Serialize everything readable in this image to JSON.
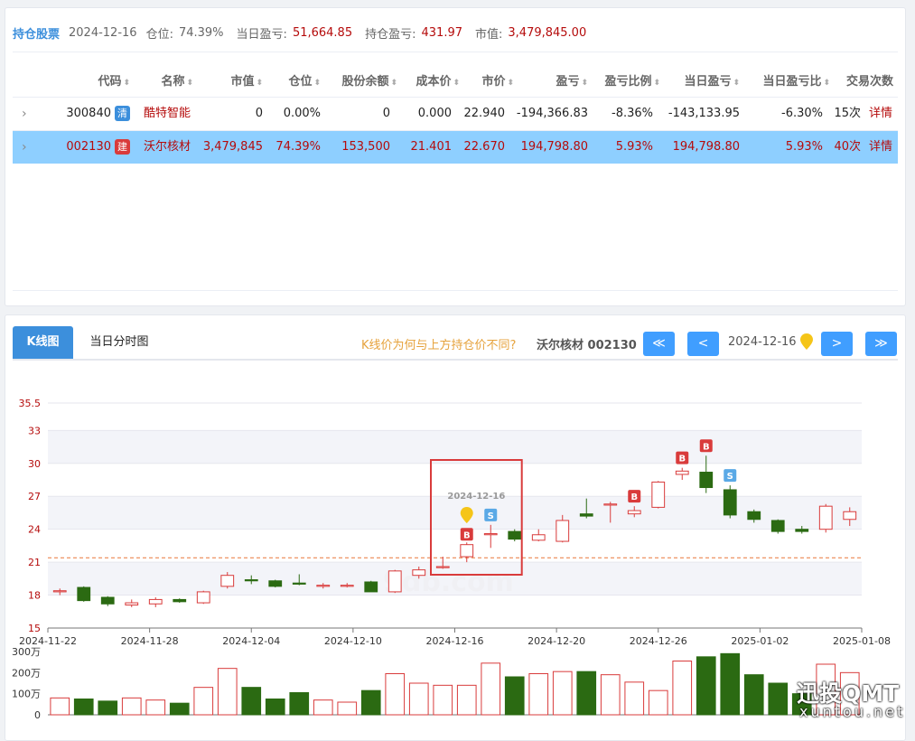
{
  "summary": {
    "title": "持仓股票",
    "date": "2024-12-16",
    "position_label": "仓位:",
    "position_value": "74.39%",
    "daily_pl_label": "当日盈亏:",
    "daily_pl_value": "51,664.85",
    "hold_pl_label": "持仓盈亏:",
    "hold_pl_value": "431.97",
    "market_value_label": "市值:",
    "market_value_value": "3,479,845.00"
  },
  "table": {
    "headers": [
      "代码",
      "名称",
      "市值",
      "仓位",
      "股份余额",
      "成本价",
      "市价",
      "盈亏",
      "盈亏比例",
      "当日盈亏",
      "当日盈亏比",
      "交易次数"
    ],
    "rows": [
      {
        "code": "300840",
        "tag": "清",
        "name": "酷特智能",
        "market_value": "0",
        "position": "0.00%",
        "shares": "0",
        "cost": "0.000",
        "price": "22.940",
        "pl": "-194,366.83",
        "pl_ratio": "-8.36%",
        "daily_pl": "-143,133.95",
        "daily_pl_ratio": "-6.30%",
        "trades": "15次",
        "detail": "详情",
        "tag_color": "#3c8fdc"
      },
      {
        "code": "002130",
        "tag": "建",
        "name": "沃尔核材",
        "market_value": "3,479,845",
        "position": "74.39%",
        "shares": "153,500",
        "cost": "21.401",
        "price": "22.670",
        "pl": "194,798.80",
        "pl_ratio": "5.93%",
        "daily_pl": "194,798.80",
        "daily_pl_ratio": "5.93%",
        "trades": "40次",
        "detail": "详情",
        "tag_color": "#d93b3b"
      }
    ]
  },
  "chart_panel": {
    "tabs": [
      "K线图",
      "当日分时图"
    ],
    "question": "K线价为何与上方持仓价不同?",
    "stock_label": "沃尔核材 002130",
    "nav": {
      "first": "≪",
      "prev": "<",
      "date": "2024-12-16",
      "next": ">",
      "last": "≫"
    }
  },
  "chart_data": {
    "type": "candlestick",
    "y_ticks": [
      "35.5",
      "33",
      "30",
      "27",
      "24",
      "21",
      "18",
      "15"
    ],
    "x_ticks": [
      "2024-11-22",
      "2024-11-28",
      "2024-12-04",
      "2024-12-10",
      "2024-12-16",
      "2024-12-20",
      "2024-12-26",
      "2025-01-02",
      "2025-01-08"
    ],
    "ylim": [
      15,
      35.5
    ],
    "cost_line": 21.4,
    "highlight_label": "2024-12-16",
    "volume_ticks": [
      "300万",
      "200万",
      "100万",
      "0"
    ],
    "volume_max": 3000000,
    "candles": [
      {
        "o": 18.3,
        "c": 18.4,
        "h": 18.6,
        "l": 18.0,
        "v": 800000
      },
      {
        "o": 18.7,
        "c": 17.5,
        "h": 18.8,
        "l": 17.4,
        "v": 750000
      },
      {
        "o": 17.8,
        "c": 17.2,
        "h": 17.9,
        "l": 17.0,
        "v": 650000
      },
      {
        "o": 17.1,
        "c": 17.3,
        "h": 17.6,
        "l": 16.9,
        "v": 800000
      },
      {
        "o": 17.2,
        "c": 17.6,
        "h": 17.8,
        "l": 16.9,
        "v": 700000
      },
      {
        "o": 17.6,
        "c": 17.4,
        "h": 17.7,
        "l": 17.3,
        "v": 550000
      },
      {
        "o": 17.3,
        "c": 18.3,
        "h": 18.4,
        "l": 17.2,
        "v": 1300000
      },
      {
        "o": 18.8,
        "c": 19.8,
        "h": 20.1,
        "l": 18.6,
        "v": 2200000
      },
      {
        "o": 19.4,
        "c": 19.3,
        "h": 19.8,
        "l": 19.0,
        "v": 1300000
      },
      {
        "o": 19.3,
        "c": 18.8,
        "h": 19.4,
        "l": 18.7,
        "v": 750000
      },
      {
        "o": 19.1,
        "c": 19.0,
        "h": 19.9,
        "l": 18.9,
        "v": 1050000
      },
      {
        "o": 18.8,
        "c": 18.9,
        "h": 19.1,
        "l": 18.6,
        "v": 700000
      },
      {
        "o": 18.8,
        "c": 18.9,
        "h": 19.1,
        "l": 18.7,
        "v": 600000
      },
      {
        "o": 19.2,
        "c": 18.3,
        "h": 19.3,
        "l": 18.3,
        "v": 1150000
      },
      {
        "o": 18.3,
        "c": 20.2,
        "h": 20.3,
        "l": 18.2,
        "v": 1950000
      },
      {
        "o": 19.8,
        "c": 20.3,
        "h": 20.6,
        "l": 19.5,
        "v": 1500000
      },
      {
        "o": 20.5,
        "c": 20.6,
        "h": 21.5,
        "l": 20.4,
        "v": 1400000
      },
      {
        "o": 21.5,
        "c": 22.6,
        "h": 22.8,
        "l": 21.0,
        "v": 1400000
      },
      {
        "o": 23.5,
        "c": 23.6,
        "h": 24.4,
        "l": 22.3,
        "v": 2450000
      },
      {
        "o": 23.8,
        "c": 23.1,
        "h": 24.0,
        "l": 22.9,
        "v": 1800000
      },
      {
        "o": 23.0,
        "c": 23.5,
        "h": 24.0,
        "l": 22.9,
        "v": 1950000
      },
      {
        "o": 22.9,
        "c": 24.8,
        "h": 25.3,
        "l": 22.8,
        "v": 2050000
      },
      {
        "o": 25.4,
        "c": 25.2,
        "h": 26.8,
        "l": 25.0,
        "v": 2050000
      },
      {
        "o": 26.2,
        "c": 26.3,
        "h": 26.5,
        "l": 24.6,
        "v": 1900000
      },
      {
        "o": 25.4,
        "c": 25.7,
        "h": 26.1,
        "l": 25.1,
        "v": 1550000
      },
      {
        "o": 26.0,
        "c": 28.3,
        "h": 28.4,
        "l": 25.9,
        "v": 1150000
      },
      {
        "o": 29.0,
        "c": 29.3,
        "h": 29.6,
        "l": 28.5,
        "v": 2550000
      },
      {
        "o": 29.2,
        "c": 27.8,
        "h": 30.7,
        "l": 27.3,
        "v": 2750000
      },
      {
        "o": 27.6,
        "c": 25.3,
        "h": 28.0,
        "l": 25.0,
        "v": 2900000
      },
      {
        "o": 25.6,
        "c": 24.9,
        "h": 25.8,
        "l": 24.6,
        "v": 1900000
      },
      {
        "o": 24.8,
        "c": 23.8,
        "h": 24.9,
        "l": 23.6,
        "v": 1500000
      },
      {
        "o": 24.0,
        "c": 23.8,
        "h": 24.3,
        "l": 23.6,
        "v": 1000000
      },
      {
        "o": 24.0,
        "c": 26.1,
        "h": 26.3,
        "l": 23.7,
        "v": 2400000
      },
      {
        "o": 24.9,
        "c": 25.6,
        "h": 26.0,
        "l": 24.3,
        "v": 2000000
      }
    ],
    "markers": [
      {
        "index": 17,
        "label": "B",
        "color": "#d93b3b",
        "side": "below"
      },
      {
        "index": 18,
        "label": "S",
        "color": "#5aa9e6",
        "side": "above"
      },
      {
        "index": 24,
        "label": "B",
        "color": "#d93b3b",
        "side": "above"
      },
      {
        "index": 26,
        "label": "B",
        "color": "#d93b3b",
        "side": "above"
      },
      {
        "index": 27,
        "label": "B",
        "color": "#d93b3b",
        "side": "above"
      },
      {
        "index": 28,
        "label": "S",
        "color": "#5aa9e6",
        "side": "above"
      }
    ]
  },
  "watermark": {
    "main": "迅投QMT",
    "sub": "xuntou.net"
  }
}
